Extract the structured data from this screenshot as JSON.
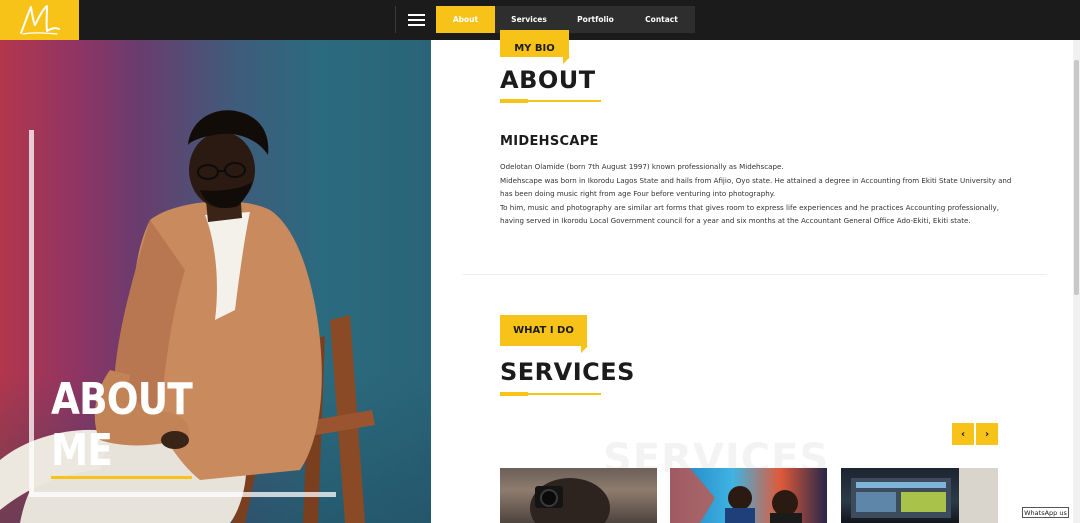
{
  "logo": {
    "initial": "M"
  },
  "nav": {
    "menu_icon": "hamburger-icon",
    "items": [
      {
        "label": "About",
        "active": true
      },
      {
        "label": "Services",
        "active": false
      },
      {
        "label": "Portfolio",
        "active": false
      },
      {
        "label": "Contact",
        "active": false
      }
    ]
  },
  "hero": {
    "title_line1": "ABOUT",
    "title_line2": "ME"
  },
  "about": {
    "tag": "MY BIO",
    "heading": "ABOUT",
    "name": "MIDEHSCAPE",
    "paragraphs": [
      "Odelotan Olamide (born 7th August 1997) known professionally as Midehscape.",
      "Midehscape was born in Ikorodu Lagos State and hails from Afijio, Oyo state. He attained a degree in Accounting from Ekiti State University and has been doing music right from age Four before venturing into photography.",
      "To him, music and photography are similar art forms that gives room to express life experiences and he practices Accounting professionally, having served in Ikorodu Local Government council for a year and six months at the Accountant General Office Ado-Ekiti, Ekiti state."
    ]
  },
  "services": {
    "tag": "WHAT I DO",
    "heading": "SERVICES",
    "ghost_text": "SERVICES",
    "prev_icon": "chevron-left-icon",
    "next_icon": "chevron-right-icon",
    "prev_glyph": "‹",
    "next_glyph": "›"
  },
  "whatsapp": {
    "label": "WhatsApp us"
  },
  "colors": {
    "accent": "#f7c318",
    "topbar": "#1b1b1b",
    "text": "#1b1b1b"
  }
}
